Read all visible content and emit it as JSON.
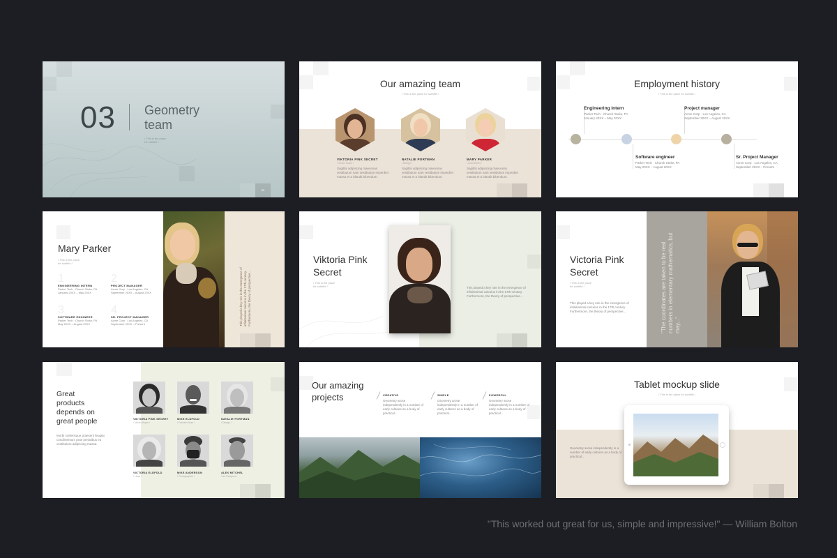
{
  "slide1": {
    "number": "03",
    "title_line1": "Geometry",
    "title_line2": "team",
    "subtitle_line1": "/ This is the place",
    "subtitle_line2": "for subtitle /",
    "page": "00"
  },
  "slide2": {
    "title": "Our amazing team",
    "subtitle": "/ This is the place for subtitle /",
    "members": [
      {
        "name": "VIKTORIA PINK SECRET",
        "role": "/ Vector Super /",
        "text": "Sagittis adipiscing maecenas vestibulum nam vestibulum imperdiet massa et a blandit bibendum."
      },
      {
        "name": "NATALIE PORTMAN",
        "role": "/ Design /",
        "text": "Sagittis adipiscing maecenas vestibulum nam vestibulum imperdiet massa et a blandit bibendum."
      },
      {
        "name": "MARY PARKER",
        "role": "/ Lead Devel /",
        "text": "Sagittis adipiscing maecenas vestibulum nam vestibulum imperdiet massa et a blandit bibendum."
      }
    ]
  },
  "slide3": {
    "title": "Employment history",
    "subtitle": "/ This is the place for subtitle /",
    "items": [
      {
        "role": "Engineering Intern",
        "line1": "Parker Tech · Church Stoke, PA",
        "line2": "January 20XX – May 20XX",
        "color": "#b7b39f"
      },
      {
        "role": "Software engineer",
        "line1": "Parker Tech · Church Stoke, PA",
        "line2": "May 20XX – August 20XX",
        "color": "#c7d3e2"
      },
      {
        "role": "Project manager",
        "line1": "Acme Corp · Los Angeles, CA",
        "line2": "September 20XX – August 20XX",
        "color": "#efd4a9"
      },
      {
        "role": "Sr. Project Manager",
        "line1": "Acme Corp · Los Angeles, CA",
        "line2": "September 20XX – Present",
        "color": "#b7b09f"
      }
    ]
  },
  "slide4": {
    "name": "Mary Parker",
    "subtitle_line1": "/ This is the place",
    "subtitle_line2": "for subtitle /",
    "jobs": [
      {
        "num": "1",
        "title": "ENGINEERING INTERN",
        "line1": "Parker Tech · Church Stoke, PA",
        "line2": "January 20XX – May 20XX"
      },
      {
        "num": "2",
        "title": "PROJECT MANAGER",
        "line1": "Acme Corp · Los Angeles, CA",
        "line2": "September 20XX – August 20XX"
      },
      {
        "num": "3",
        "title": "SOFTWARE ENGINEER",
        "line1": "Parker Tech · Church Stoke, PA",
        "line2": "May 20XX – August 20XX"
      },
      {
        "num": "4",
        "title": "SR. PROJECT MANAGER",
        "line1": "Acme Corp · Los Angeles, CA",
        "line2": "September 20XX – Present"
      }
    ],
    "vertical_text": "This played a key role in the emergence of infinitesimal calculus in the 17th century. Furthermore, the theory of perspective..."
  },
  "slide5": {
    "name_line1": "Viktoria Pink",
    "name_line2": "Secret",
    "subtitle_line1": "/ This is the place",
    "subtitle_line2": "for subtitle /",
    "text": "This played a key role in the emergence of infinitesimal calculus in the 17th century. Furthermore, the theory of perspective..."
  },
  "slide6": {
    "name_line1": "Victoria Pink",
    "name_line2": "Secret",
    "subtitle_line1": "/ This is the place",
    "subtitle_line2": "for subtitle /",
    "text": "This played a key role in the emergence of infinitesimal calculus in the 17th century. Furthermore, the theory of perspective...",
    "quote": "\"The coordinates are taken to be real numbers in elementary mathematics, but may...\""
  },
  "slide7": {
    "title_line1": "Great",
    "title_line2": "products",
    "title_line3": "depends on",
    "title_line4": "great people",
    "text": "Morbi scelerisque praesent feugiat condimentum prae penatibus eu vestibulum adipiscing massa.",
    "people": [
      {
        "name": "VIKTORIA PINK SECRET",
        "role": "/ Vector Super /"
      },
      {
        "name": "MIKE ELDFOLD",
        "role": "/ Fashion Boss /"
      },
      {
        "name": "NATALIE PORTMAN",
        "role": "/ Design /"
      },
      {
        "name": "VICTORIA ELDFOLD",
        "role": "/ Lead /"
      },
      {
        "name": "MIKE ANDERSON",
        "role": "/ Photographer /"
      },
      {
        "name": "ALEX MITCHEL",
        "role": "/ Art Designer /"
      }
    ]
  },
  "slide8": {
    "title_line1": "Our amazing",
    "title_line2": "projects",
    "columns": [
      {
        "label": "CREATIVE",
        "text": "Geometry arose independently in a number of early cultures as a body of practical..."
      },
      {
        "label": "SIMPLE",
        "text": "Geometry arose independently in a number of early cultures as a body of practical..."
      },
      {
        "label": "POWERFUL",
        "text": "Geometry arose independently in a number of early cultures as a body of practical..."
      }
    ]
  },
  "slide9": {
    "title": "Tablet mockup slide",
    "subtitle": "/ This is the place for subtitle /",
    "text": "Geometry arose independently in a number of early cultures as a body of practical..."
  },
  "testimonial": "\"This worked out great for us, simple and impressive!\" — William Bolton"
}
